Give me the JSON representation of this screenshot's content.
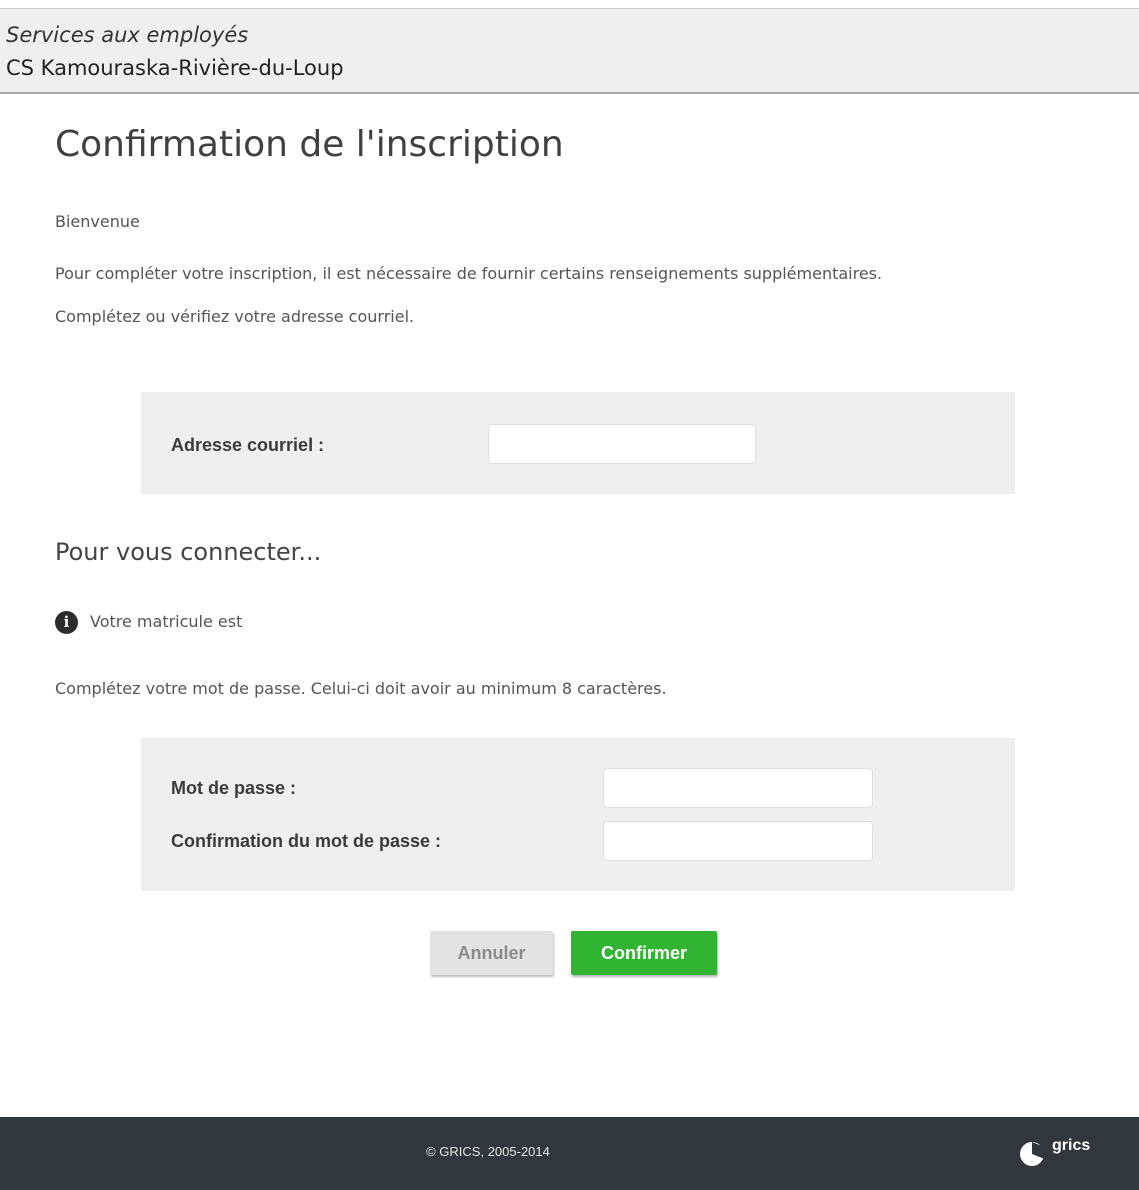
{
  "header": {
    "portal_name": "Services aux employés",
    "organization": "CS Kamouraska-Rivière-du-Loup"
  },
  "main": {
    "title": "Confirmation de l'inscription",
    "welcome": "Bienvenue",
    "intro": "Pour compléter votre inscription, il est nécessaire de fournir certains renseignements supplémentaires.",
    "email_instruction": "Complétez ou vérifiez votre adresse courriel.",
    "email_form": {
      "label": "Adresse courriel :",
      "value": "",
      "placeholder": ""
    },
    "login_section_title": "Pour vous connecter...",
    "matricule_info": "Votre matricule est",
    "password_instruction": "Complétez votre mot de passe. Celui-ci doit avoir au minimum 8 caractères.",
    "password_form": {
      "password_label": "Mot de passe :",
      "password_value": "",
      "confirm_label": "Confirmation du mot de passe :",
      "confirm_value": ""
    },
    "actions": {
      "cancel_label": "Annuler",
      "confirm_label": "Confirmer"
    }
  },
  "footer": {
    "copyright": "© GRICS, 2005-2014",
    "logo_text": "grics"
  },
  "colors": {
    "primary_button": "#30b431",
    "secondary_button": "#e3e3e3",
    "footer_background": "#31373d",
    "panel_background": "#efefef"
  },
  "icons": {
    "info": "info-circle-icon",
    "logo": "grics-logo-icon"
  }
}
